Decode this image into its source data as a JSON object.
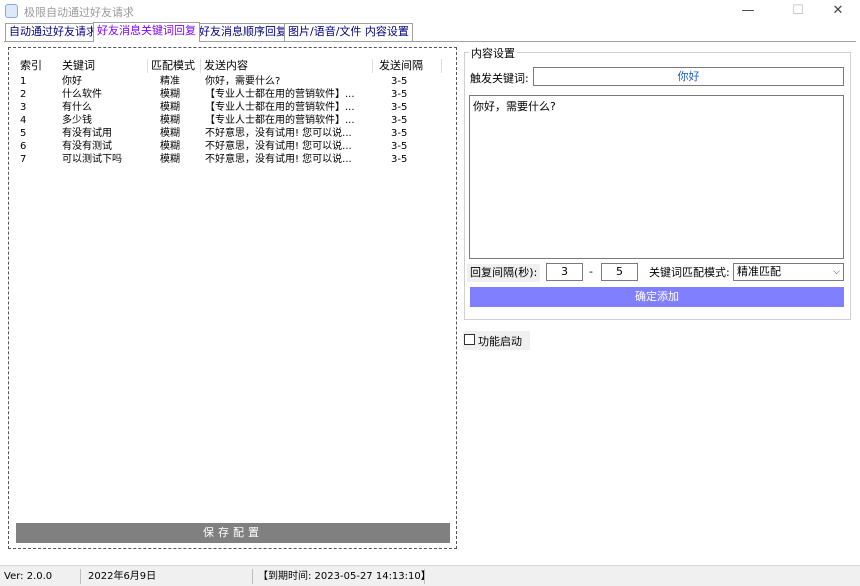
{
  "window": {
    "title": "极限自动通过好友请求",
    "minimize": "—",
    "maximize": "☐",
    "close": "✕"
  },
  "tabs": [
    {
      "label": "自动通过好友请求",
      "active": false
    },
    {
      "label": "好友消息关键词回复",
      "active": true
    },
    {
      "label": "好友消息顺序回复",
      "active": false
    },
    {
      "label": "图片/语音/文件 内容设置",
      "active": false
    }
  ],
  "table": {
    "columns": [
      "索引",
      "关键词",
      "匹配模式",
      "发送内容",
      "发送间隔"
    ],
    "rows": [
      {
        "idx": "1",
        "keyword": "你好",
        "mode": "精准",
        "content": "你好，需要什么?",
        "interval": "3-5"
      },
      {
        "idx": "2",
        "keyword": "什么软件",
        "mode": "模糊",
        "content": "【专业人士都在用的营销软件】...",
        "interval": "3-5"
      },
      {
        "idx": "3",
        "keyword": "有什么",
        "mode": "模糊",
        "content": "【专业人士都在用的营销软件】...",
        "interval": "3-5"
      },
      {
        "idx": "4",
        "keyword": "多少钱",
        "mode": "模糊",
        "content": "【专业人士都在用的营销软件】...",
        "interval": "3-5"
      },
      {
        "idx": "5",
        "keyword": "有没有试用",
        "mode": "模糊",
        "content": "不好意思，没有试用! 您可以说...",
        "interval": "3-5"
      },
      {
        "idx": "6",
        "keyword": "有没有测试",
        "mode": "模糊",
        "content": "不好意思，没有试用! 您可以说...",
        "interval": "3-5"
      },
      {
        "idx": "7",
        "keyword": "可以测试下吗",
        "mode": "模糊",
        "content": "不好意思，没有试用! 您可以说...",
        "interval": "3-5"
      }
    ]
  },
  "save_button": "保存配置",
  "content_settings": {
    "legend": "内容设置",
    "keyword_label": "触发关键词:",
    "keyword_value": "你好",
    "reply_text": "你好，需要什么?",
    "interval_label": "回复间隔(秒):",
    "interval_from": "3",
    "interval_dash": "-",
    "interval_to": "5",
    "mode_label": "关键词匹配模式:",
    "mode_value": "精准匹配",
    "add_button": "确定添加"
  },
  "feature_toggle": {
    "label": "功能启动",
    "checked": false
  },
  "status": {
    "version": "Ver: 2.0.0",
    "date": "2022年6月9日",
    "expiry": "【到期时间: 2023-05-27 14:13:10】"
  },
  "colors": {
    "active_tab": "#8000ff",
    "tab_text": "#000080",
    "add_button": "#8080ff",
    "save_button": "#808080",
    "keyword_value": "#1a5fd0"
  },
  "icons": {
    "app": "app-icon",
    "dropdown": "chevron-down-icon"
  }
}
